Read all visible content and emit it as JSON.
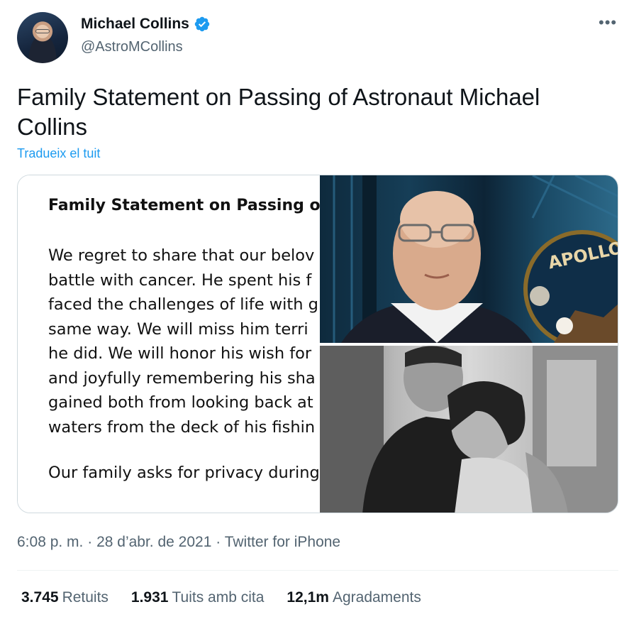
{
  "author": {
    "display_name": "Michael Collins",
    "handle": "@AstroMCollins",
    "verified_icon": "verified-badge-icon"
  },
  "more_icon": "•••",
  "tweet": {
    "text": "Family Statement on Passing of Astronaut Michael Collins",
    "translate_label": "Tradueix el tuit"
  },
  "media": {
    "document": {
      "title": "Family Statement on Passing of A",
      "lines": [
        "We regret to share that our belov",
        "battle with cancer. He spent his f",
        "faced the challenges of life with g",
        "same way. We will miss him terri",
        "he did. We will honor his wish for",
        "and joyfully remembering his sha",
        "gained both from looking back at",
        "waters from the deck of his fishin"
      ],
      "privacy_line": "Our family asks for privacy during"
    },
    "photo_top_sign": "APOLLO"
  },
  "meta": {
    "time": "6:08 p. m.",
    "date": "28 d’abr. de 2021",
    "source": "Twitter for iPhone",
    "separator": "·"
  },
  "stats": {
    "retweets_count": "3.745",
    "retweets_label": "Retuits",
    "quotes_count": "1.931",
    "quotes_label": "Tuits amb cita",
    "likes_count": "12,1m",
    "likes_label": "Agradaments"
  },
  "colors": {
    "accent": "#1d9bf0",
    "secondary_text": "#536471",
    "primary_text": "#0f1419",
    "border": "#cfd9de"
  }
}
